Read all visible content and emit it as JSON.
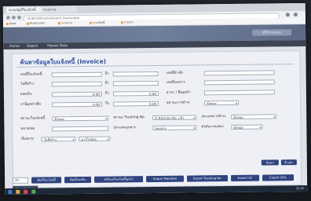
{
  "browser": {
    "tabs": [
      "ระบบบัญชีใบแจ้งหนี้",
      "ระบบงาน"
    ],
    "url": "localhost/invoice/search_invoice.php",
    "bookmarks": [
      "Apps",
      "Bookmarks",
      "ระบบงาน",
      "ระบบบัญชี",
      "รายงาน"
    ]
  },
  "header": {
    "user": "ผู้ใช้งานระบบ"
  },
  "menu": [
    "Home",
    "Report",
    "Master Data"
  ],
  "form": {
    "title": "ค้นหาข้อมูลใบแจ้งหนี้ (Invoice)",
    "invoice_no_label": "เลขที่ใบแจ้งหนี้",
    "invoice_no_from": "",
    "invoice_no_to_label": "ถึง",
    "invoice_no_to": "",
    "ref_no_label": "เลขที่อ้างอิง",
    "ref_no_value": "",
    "date_label": "วันที่สร้าง",
    "date_from": "",
    "date_to_label": "ถึง",
    "date_to": "",
    "doc_no_label": "เลขที่เอกสาร",
    "doc_no_value": "",
    "amount_label": "ยอดเงิน",
    "amount_from": "0.00",
    "amount_to_label": "ถึง",
    "amount_to": "0.00",
    "branch_label": "สาขา / ชื่อลูกค้า",
    "branch_value": "",
    "vat_label": "ภาษีมูลค่าเพิ่ม",
    "vat_from": "0.00",
    "vat_to_label": "ถึง",
    "vat_to": "0.00",
    "pay_status_label": "สถานะการชำระ",
    "pay_status_value": "ทั้งหมด",
    "status_label": "สถานะใบแจ้งหนี้",
    "status_value": "ทั้งหมด",
    "tracking_label": "สถานะ Tracking No.",
    "tracking_value": "มี Tracking No. แล้ว",
    "payment_type_label": "ประเภทการชำระ",
    "payment_type_value": "ทั้งหมด",
    "remark_label": "หมายเหตุ",
    "remark_value": "",
    "doc_type_label": "ประเภทเอกสาร",
    "doc_type_value": "Invoice",
    "sort_label": "ลำดับการแสดง",
    "sort_value": "ทั้งหมด",
    "order_label": "เรียงตาม",
    "order_value": "วันที่สร้าง",
    "direction_value": "มากไปน้อย",
    "search_button": "ค้นหา",
    "clear_button": "ล้างค่า"
  },
  "toolbar": {
    "page_size": "20",
    "buttons": [
      "พิมพ์ใบแจ้งหนี้",
      "พิมพ์ใบเสร็จ",
      "ส่งอีเมลใบแจ้งหนี้ลูกค้า",
      "Export Manifest",
      "Export Tracking No.",
      "Export SC",
      "Export DHL"
    ],
    "export_label": "Export Label"
  },
  "taskbar": {
    "clock": "10:45"
  }
}
